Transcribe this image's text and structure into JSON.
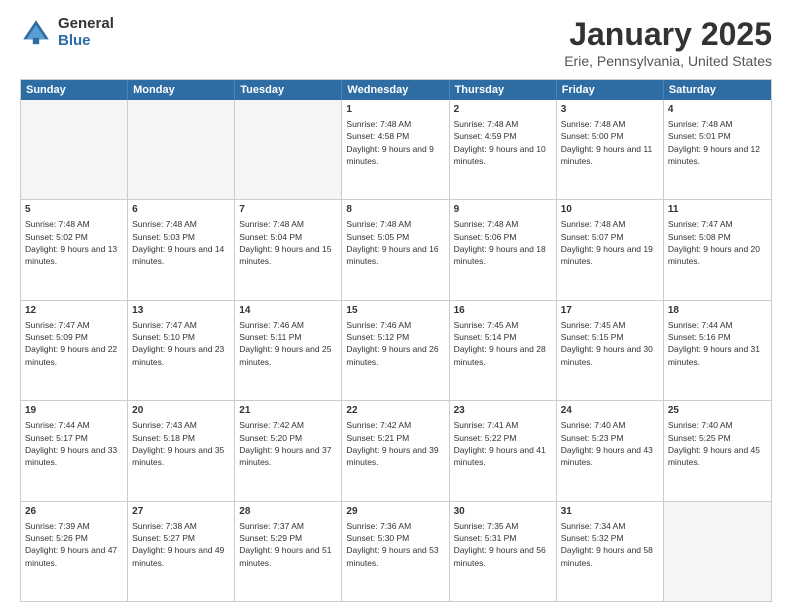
{
  "logo": {
    "general": "General",
    "blue": "Blue"
  },
  "header": {
    "month": "January 2025",
    "location": "Erie, Pennsylvania, United States"
  },
  "days": [
    "Sunday",
    "Monday",
    "Tuesday",
    "Wednesday",
    "Thursday",
    "Friday",
    "Saturday"
  ],
  "rows": [
    [
      {
        "day": "",
        "sunrise": "",
        "sunset": "",
        "daylight": "",
        "shaded": true
      },
      {
        "day": "",
        "sunrise": "",
        "sunset": "",
        "daylight": "",
        "shaded": true
      },
      {
        "day": "",
        "sunrise": "",
        "sunset": "",
        "daylight": "",
        "shaded": true
      },
      {
        "day": "1",
        "sunrise": "Sunrise: 7:48 AM",
        "sunset": "Sunset: 4:58 PM",
        "daylight": "Daylight: 9 hours and 9 minutes."
      },
      {
        "day": "2",
        "sunrise": "Sunrise: 7:48 AM",
        "sunset": "Sunset: 4:59 PM",
        "daylight": "Daylight: 9 hours and 10 minutes."
      },
      {
        "day": "3",
        "sunrise": "Sunrise: 7:48 AM",
        "sunset": "Sunset: 5:00 PM",
        "daylight": "Daylight: 9 hours and 11 minutes."
      },
      {
        "day": "4",
        "sunrise": "Sunrise: 7:48 AM",
        "sunset": "Sunset: 5:01 PM",
        "daylight": "Daylight: 9 hours and 12 minutes."
      }
    ],
    [
      {
        "day": "5",
        "sunrise": "Sunrise: 7:48 AM",
        "sunset": "Sunset: 5:02 PM",
        "daylight": "Daylight: 9 hours and 13 minutes."
      },
      {
        "day": "6",
        "sunrise": "Sunrise: 7:48 AM",
        "sunset": "Sunset: 5:03 PM",
        "daylight": "Daylight: 9 hours and 14 minutes."
      },
      {
        "day": "7",
        "sunrise": "Sunrise: 7:48 AM",
        "sunset": "Sunset: 5:04 PM",
        "daylight": "Daylight: 9 hours and 15 minutes."
      },
      {
        "day": "8",
        "sunrise": "Sunrise: 7:48 AM",
        "sunset": "Sunset: 5:05 PM",
        "daylight": "Daylight: 9 hours and 16 minutes."
      },
      {
        "day": "9",
        "sunrise": "Sunrise: 7:48 AM",
        "sunset": "Sunset: 5:06 PM",
        "daylight": "Daylight: 9 hours and 18 minutes."
      },
      {
        "day": "10",
        "sunrise": "Sunrise: 7:48 AM",
        "sunset": "Sunset: 5:07 PM",
        "daylight": "Daylight: 9 hours and 19 minutes."
      },
      {
        "day": "11",
        "sunrise": "Sunrise: 7:47 AM",
        "sunset": "Sunset: 5:08 PM",
        "daylight": "Daylight: 9 hours and 20 minutes."
      }
    ],
    [
      {
        "day": "12",
        "sunrise": "Sunrise: 7:47 AM",
        "sunset": "Sunset: 5:09 PM",
        "daylight": "Daylight: 9 hours and 22 minutes."
      },
      {
        "day": "13",
        "sunrise": "Sunrise: 7:47 AM",
        "sunset": "Sunset: 5:10 PM",
        "daylight": "Daylight: 9 hours and 23 minutes."
      },
      {
        "day": "14",
        "sunrise": "Sunrise: 7:46 AM",
        "sunset": "Sunset: 5:11 PM",
        "daylight": "Daylight: 9 hours and 25 minutes."
      },
      {
        "day": "15",
        "sunrise": "Sunrise: 7:46 AM",
        "sunset": "Sunset: 5:12 PM",
        "daylight": "Daylight: 9 hours and 26 minutes."
      },
      {
        "day": "16",
        "sunrise": "Sunrise: 7:45 AM",
        "sunset": "Sunset: 5:14 PM",
        "daylight": "Daylight: 9 hours and 28 minutes."
      },
      {
        "day": "17",
        "sunrise": "Sunrise: 7:45 AM",
        "sunset": "Sunset: 5:15 PM",
        "daylight": "Daylight: 9 hours and 30 minutes."
      },
      {
        "day": "18",
        "sunrise": "Sunrise: 7:44 AM",
        "sunset": "Sunset: 5:16 PM",
        "daylight": "Daylight: 9 hours and 31 minutes."
      }
    ],
    [
      {
        "day": "19",
        "sunrise": "Sunrise: 7:44 AM",
        "sunset": "Sunset: 5:17 PM",
        "daylight": "Daylight: 9 hours and 33 minutes."
      },
      {
        "day": "20",
        "sunrise": "Sunrise: 7:43 AM",
        "sunset": "Sunset: 5:18 PM",
        "daylight": "Daylight: 9 hours and 35 minutes."
      },
      {
        "day": "21",
        "sunrise": "Sunrise: 7:42 AM",
        "sunset": "Sunset: 5:20 PM",
        "daylight": "Daylight: 9 hours and 37 minutes."
      },
      {
        "day": "22",
        "sunrise": "Sunrise: 7:42 AM",
        "sunset": "Sunset: 5:21 PM",
        "daylight": "Daylight: 9 hours and 39 minutes."
      },
      {
        "day": "23",
        "sunrise": "Sunrise: 7:41 AM",
        "sunset": "Sunset: 5:22 PM",
        "daylight": "Daylight: 9 hours and 41 minutes."
      },
      {
        "day": "24",
        "sunrise": "Sunrise: 7:40 AM",
        "sunset": "Sunset: 5:23 PM",
        "daylight": "Daylight: 9 hours and 43 minutes."
      },
      {
        "day": "25",
        "sunrise": "Sunrise: 7:40 AM",
        "sunset": "Sunset: 5:25 PM",
        "daylight": "Daylight: 9 hours and 45 minutes."
      }
    ],
    [
      {
        "day": "26",
        "sunrise": "Sunrise: 7:39 AM",
        "sunset": "Sunset: 5:26 PM",
        "daylight": "Daylight: 9 hours and 47 minutes."
      },
      {
        "day": "27",
        "sunrise": "Sunrise: 7:38 AM",
        "sunset": "Sunset: 5:27 PM",
        "daylight": "Daylight: 9 hours and 49 minutes."
      },
      {
        "day": "28",
        "sunrise": "Sunrise: 7:37 AM",
        "sunset": "Sunset: 5:29 PM",
        "daylight": "Daylight: 9 hours and 51 minutes."
      },
      {
        "day": "29",
        "sunrise": "Sunrise: 7:36 AM",
        "sunset": "Sunset: 5:30 PM",
        "daylight": "Daylight: 9 hours and 53 minutes."
      },
      {
        "day": "30",
        "sunrise": "Sunrise: 7:35 AM",
        "sunset": "Sunset: 5:31 PM",
        "daylight": "Daylight: 9 hours and 56 minutes."
      },
      {
        "day": "31",
        "sunrise": "Sunrise: 7:34 AM",
        "sunset": "Sunset: 5:32 PM",
        "daylight": "Daylight: 9 hours and 58 minutes."
      },
      {
        "day": "",
        "sunrise": "",
        "sunset": "",
        "daylight": "",
        "shaded": true
      }
    ]
  ]
}
